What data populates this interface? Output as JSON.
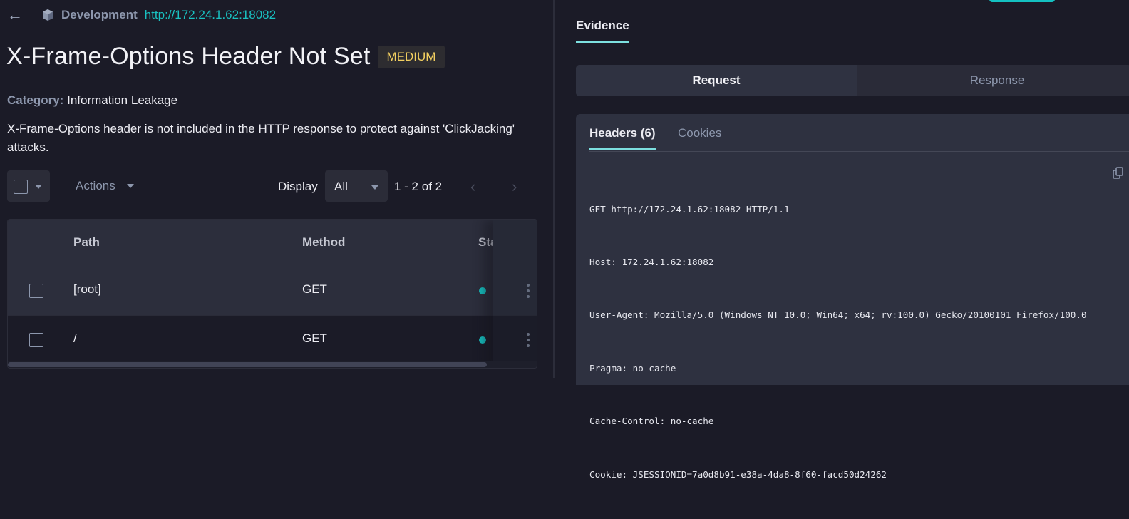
{
  "header": {
    "environment": "Development",
    "url": "http://172.24.1.62:18082"
  },
  "finding": {
    "title": "X-Frame-Options Header Not Set",
    "severity": "MEDIUM",
    "severity_color": "#f2cf60",
    "category_label": "Category:",
    "category_value": "Information Leakage",
    "description": "X-Frame-Options header is not included in the HTTP response to protect against 'ClickJacking' attacks."
  },
  "toolbar": {
    "actions_label": "Actions",
    "display_label": "Display",
    "display_value": "All",
    "range": "1 - 2 of 2"
  },
  "table": {
    "columns": [
      "Path",
      "Method",
      "Sta"
    ],
    "rows": [
      {
        "path": "[root]",
        "method": "GET",
        "status_color": "#15bfbf"
      },
      {
        "path": "/",
        "method": "GET",
        "status_color": "#15bfbf"
      }
    ]
  },
  "evidence": {
    "tab_label": "Evidence",
    "segments": [
      "Request",
      "Response"
    ],
    "active_segment": "Request",
    "subtabs": [
      "Headers (6)",
      "Cookies"
    ],
    "active_subtab": "Headers (6)",
    "request_lines": [
      "GET http://172.24.1.62:18082 HTTP/1.1",
      "Host: 172.24.1.62:18082",
      "User-Agent: Mozilla/5.0 (Windows NT 10.0; Win64; x64; rv:100.0) Gecko/20100101 Firefox/100.0",
      "Pragma: no-cache",
      "Cache-Control: no-cache",
      "Cookie: JSESSIONID=7a0d8b91-e38a-4da8-8f60-facd50d24262"
    ]
  },
  "colors": {
    "accent": "#19c1c1",
    "background": "#1b1b27",
    "panel": "#2e3140"
  }
}
